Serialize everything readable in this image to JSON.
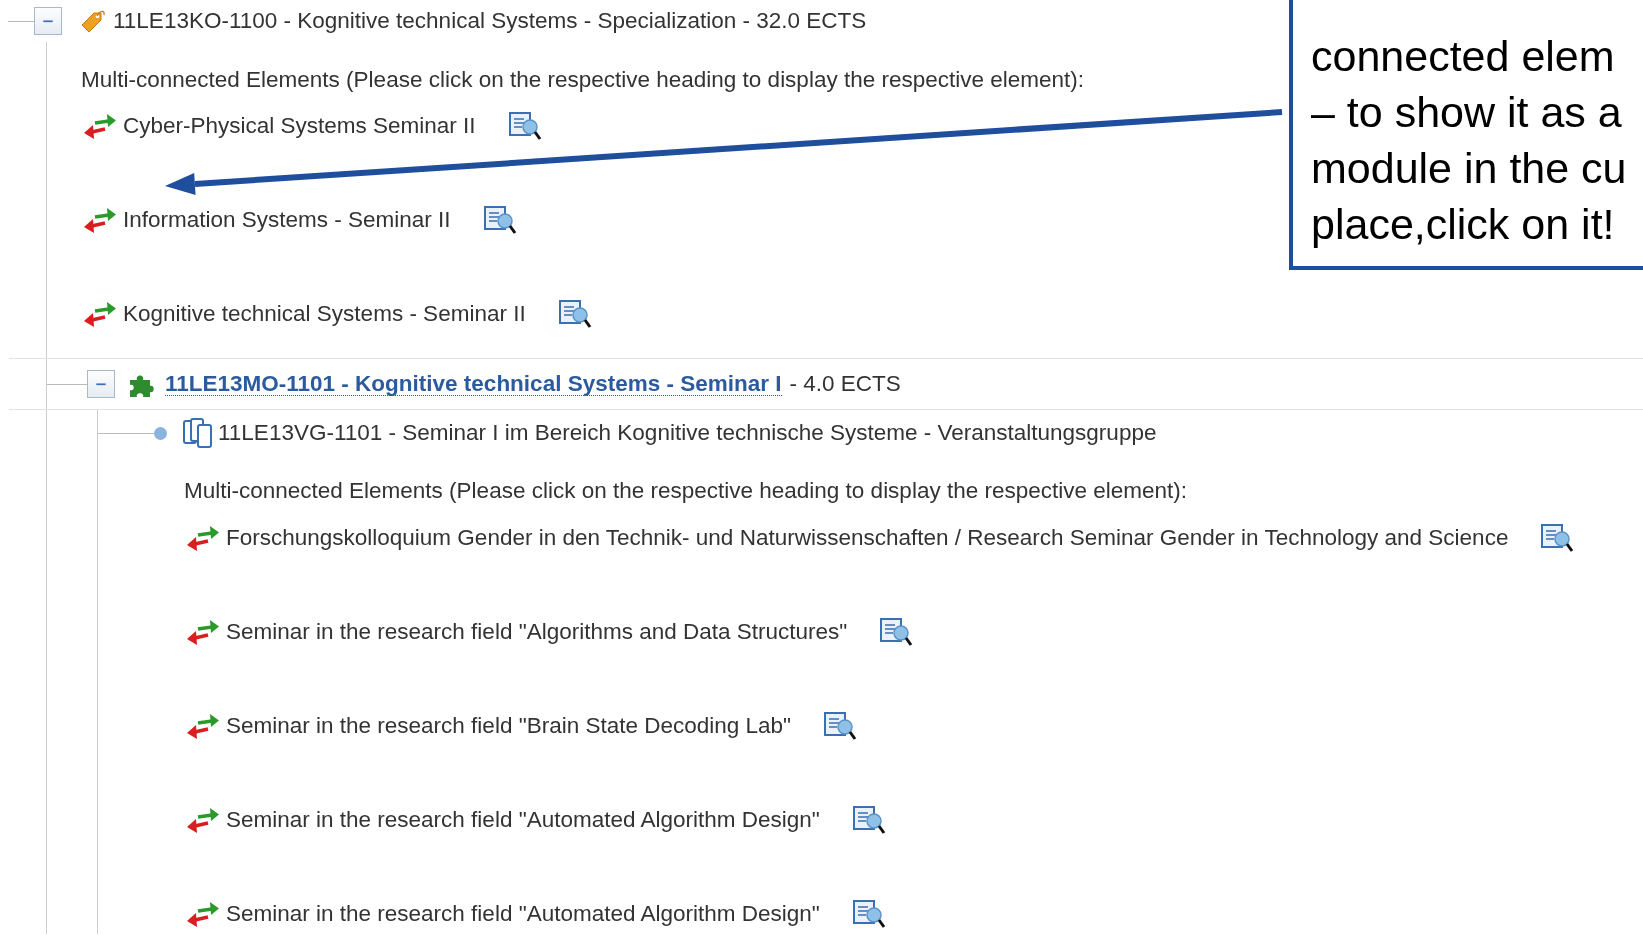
{
  "specialization": {
    "expanded": true,
    "title": "11LE13KO-1100 - Kognitive technical Systems - Specialization - 32.0 ECTS",
    "note": "Multi-connected Elements (Please click on the respective heading to display the respective element):",
    "connected": [
      {
        "label": "Cyber-Physical Systems Seminar II"
      },
      {
        "label": "Information Systems - Seminar II"
      },
      {
        "label": "Kognitive technical Systems - Seminar II"
      }
    ],
    "module": {
      "expanded": true,
      "link": "11LE13MO-1101 - Kognitive technical Systems - Seminar I",
      "suffix": "- 4.0 ECTS",
      "group": {
        "title": "11LE13VG-1101 - Seminar I im Bereich Kognitive technische Systeme - Veranstaltungsgruppe",
        "note": "Multi-connected Elements (Please click on the respective heading to display the respective element):",
        "connected": [
          {
            "label": "Forschungskolloquium Gender in den Technik- und Naturwissenschaften / Research Seminar Gender in Technology and Science"
          },
          {
            "label": "Seminar in the research field \"Algorithms and Data Structures\""
          },
          {
            "label": "Seminar in the research field \"Brain State Decoding Lab\""
          },
          {
            "label": "Seminar in the research field \"Automated Algorithm Design\""
          },
          {
            "label": "Seminar in the research field \"Automated Algorithm Design\""
          }
        ]
      }
    }
  },
  "callout": {
    "lines": [
      "connected elem",
      "– to show it as a",
      "module in the cu",
      "place,click on it!"
    ]
  }
}
